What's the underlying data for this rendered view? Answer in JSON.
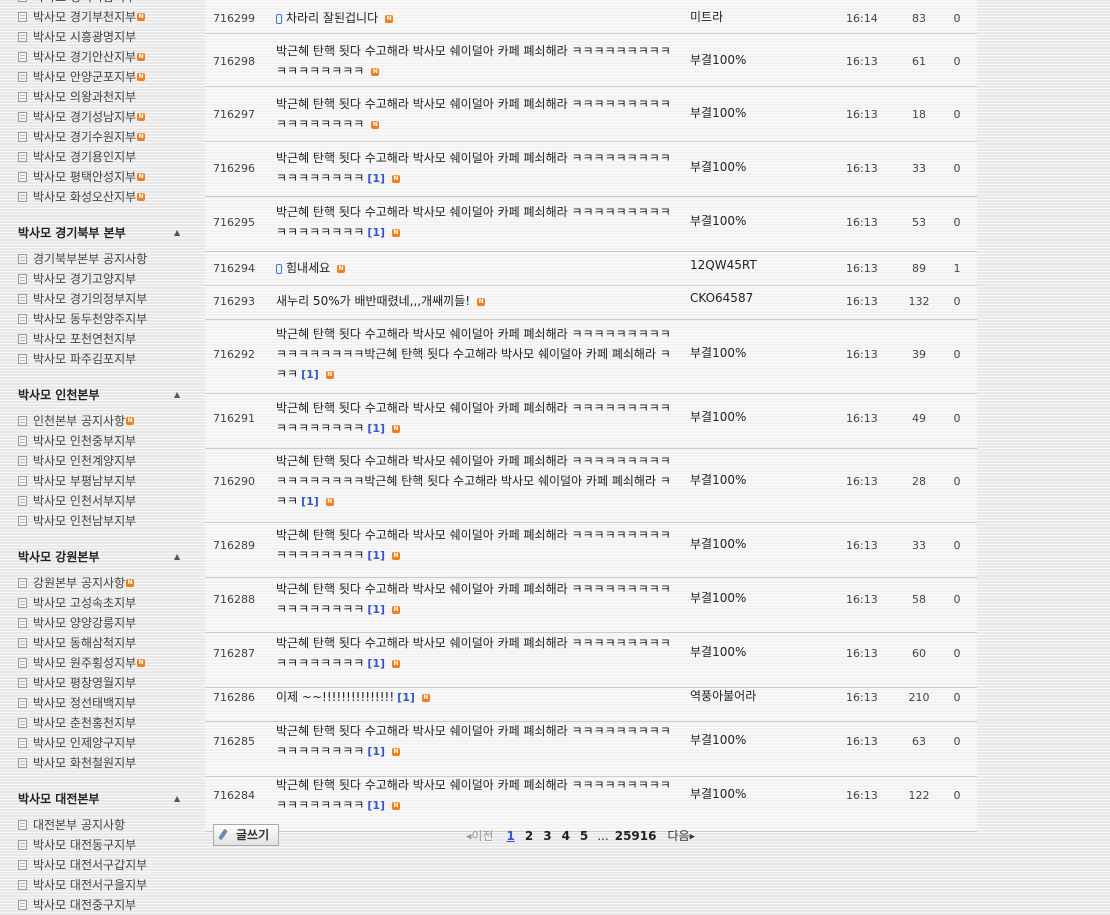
{
  "sidebar": {
    "groups": [
      {
        "header": "",
        "items": [
          {
            "label": "박사모 경기하남지부",
            "new": false
          },
          {
            "label": "박사모 경기부천지부",
            "new": true
          },
          {
            "label": "박사모 시흥광명지부",
            "new": false
          },
          {
            "label": "박사모 경기안산지부",
            "new": true
          },
          {
            "label": "박사모 안양군포지부",
            "new": true
          },
          {
            "label": "박사모 의왕과천지부",
            "new": false
          },
          {
            "label": "박사모 경기성남지부",
            "new": true
          },
          {
            "label": "박사모 경기수원지부",
            "new": true
          },
          {
            "label": "박사모 경기용인지부",
            "new": false
          },
          {
            "label": "박사모 평택안성지부",
            "new": true
          },
          {
            "label": "박사모 화성오산지부",
            "new": true
          }
        ]
      },
      {
        "header": "박사모 경기북부 본부",
        "items": [
          {
            "label": "경기북부본부 공지사항",
            "new": false
          },
          {
            "label": "박사모 경기고양지부",
            "new": false
          },
          {
            "label": "박사모 경기의정부지부",
            "new": false
          },
          {
            "label": "박사모 동두천양주지부",
            "new": false
          },
          {
            "label": "박사모 포천연천지부",
            "new": false
          },
          {
            "label": "박사모 파주김포지부",
            "new": false
          }
        ]
      },
      {
        "header": "박사모 인천본부",
        "items": [
          {
            "label": "인천본부 공지사항",
            "new": true
          },
          {
            "label": "박사모 인천중부지부",
            "new": false
          },
          {
            "label": "박사모 인천계양지부",
            "new": false
          },
          {
            "label": "박사모 부평남부지부",
            "new": false
          },
          {
            "label": "박사모 인천서부지부",
            "new": false
          },
          {
            "label": "박사모 인천남부지부",
            "new": false
          }
        ]
      },
      {
        "header": "박사모 강원본부",
        "items": [
          {
            "label": "강원본부 공지사항",
            "new": true
          },
          {
            "label": "박사모 고성속초지부",
            "new": false
          },
          {
            "label": "박사모 양양강릉지부",
            "new": false
          },
          {
            "label": "박사모 동해삼척지부",
            "new": false
          },
          {
            "label": "박사모 원주횡성지부",
            "new": true
          },
          {
            "label": "박사모 평창영월지부",
            "new": false
          },
          {
            "label": "박사모 정선태백지부",
            "new": false
          },
          {
            "label": "박사모 춘천홍천지부",
            "new": false
          },
          {
            "label": "박사모 인제양구지부",
            "new": false
          },
          {
            "label": "박사모 화천철원지부",
            "new": false
          }
        ]
      },
      {
        "header": "박사모 대전본부",
        "items": [
          {
            "label": "대전본부 공지사항",
            "new": false
          },
          {
            "label": "박사모 대전동구지부",
            "new": false
          },
          {
            "label": "박사모 대전서구갑지부",
            "new": false
          },
          {
            "label": "박사모 대전서구을지부",
            "new": false
          },
          {
            "label": "박사모 대전중구지부",
            "new": false
          }
        ]
      }
    ]
  },
  "icons": {
    "new_badge": "N",
    "new_badge_color": "#f07e1b",
    "comment_color": "#3b55c4",
    "mobile_icon": "mobile-phone-icon",
    "toggle_icon": "▲"
  },
  "posts": [
    {
      "no": "716299",
      "title": "차라리 잘된겁니다",
      "mobile": true,
      "comments": "",
      "author": "미트라",
      "time": "16:14",
      "hits": "83",
      "rec": "0"
    },
    {
      "no": "716298",
      "title": "박근혜 탄핵 됫다 수고해라 박사모 쉐이덜아 카페 폐쇠해라 ㅋㅋㅋㅋㅋㅋㅋㅋㅋㅋㅋㅋㅋㅋㅋㅋㅋ",
      "mobile": false,
      "comments": "",
      "author": "부결100%",
      "time": "16:13",
      "hits": "61",
      "rec": "0"
    },
    {
      "no": "716297",
      "title": "박근혜 탄핵 됫다 수고해라 박사모 쉐이덜아 카페 폐쇠해라 ㅋㅋㅋㅋㅋㅋㅋㅋㅋㅋㅋㅋㅋㅋㅋㅋㅋ",
      "mobile": false,
      "comments": "",
      "author": "부결100%",
      "time": "16:13",
      "hits": "18",
      "rec": "0"
    },
    {
      "no": "716296",
      "title": "박근혜 탄핵 됫다 수고해라 박사모 쉐이덜아 카페 폐쇠해라 ㅋㅋㅋㅋㅋㅋㅋㅋㅋㅋㅋㅋㅋㅋㅋㅋㅋ",
      "mobile": false,
      "comments": "[1]",
      "author": "부결100%",
      "time": "16:13",
      "hits": "33",
      "rec": "0"
    },
    {
      "no": "716295",
      "title": "박근혜 탄핵 됫다 수고해라 박사모 쉐이덜아 카페 폐쇠해라 ㅋㅋㅋㅋㅋㅋㅋㅋㅋㅋㅋㅋㅋㅋㅋㅋㅋ",
      "mobile": false,
      "comments": "[1]",
      "author": "부결100%",
      "time": "16:13",
      "hits": "53",
      "rec": "0"
    },
    {
      "no": "716294",
      "title": "힘내세요",
      "mobile": true,
      "comments": "",
      "author": "12QW45RT",
      "time": "16:13",
      "hits": "89",
      "rec": "1"
    },
    {
      "no": "716293",
      "title": "새누리 50%가 배반때렸네,,,개쌔끼들!",
      "mobile": false,
      "comments": "",
      "author": "CKO64587",
      "time": "16:13",
      "hits": "132",
      "rec": "0"
    },
    {
      "no": "716292",
      "title": "박근혜 탄핵 됫다 수고해라 박사모 쉐이덜아 카페 폐쇠해라 ㅋㅋㅋㅋㅋㅋㅋㅋㅋㅋㅋㅋㅋㅋㅋㅋㅋ박근혜 탄핵 됫다 수고해라 박사모 쉐이덜아 카페 폐쇠해라 ㅋㅋㅋ",
      "mobile": false,
      "comments": "[1]",
      "author": "부결100%",
      "time": "16:13",
      "hits": "39",
      "rec": "0"
    },
    {
      "no": "716291",
      "title": "박근혜 탄핵 됫다 수고해라 박사모 쉐이덜아 카페 폐쇠해라 ㅋㅋㅋㅋㅋㅋㅋㅋㅋㅋㅋㅋㅋㅋㅋㅋㅋ",
      "mobile": false,
      "comments": "[1]",
      "author": "부결100%",
      "time": "16:13",
      "hits": "49",
      "rec": "0"
    },
    {
      "no": "716290",
      "title": "박근혜 탄핵 됫다 수고해라 박사모 쉐이덜아 카페 폐쇠해라 ㅋㅋㅋㅋㅋㅋㅋㅋㅋㅋㅋㅋㅋㅋㅋㅋㅋ박근혜 탄핵 됫다 수고해라 박사모 쉐이덜아 카페 폐쇠해라 ㅋㅋㅋ",
      "mobile": false,
      "comments": "[1]",
      "author": "부결100%",
      "time": "16:13",
      "hits": "28",
      "rec": "0"
    },
    {
      "no": "716289",
      "title": "박근혜 탄핵 됫다 수고해라 박사모 쉐이덜아 카페 폐쇠해라 ㅋㅋㅋㅋㅋㅋㅋㅋㅋㅋㅋㅋㅋㅋㅋㅋㅋ",
      "mobile": false,
      "comments": "[1]",
      "author": "부결100%",
      "time": "16:13",
      "hits": "33",
      "rec": "0"
    },
    {
      "no": "716288",
      "title": "박근혜 탄핵 됫다 수고해라 박사모 쉐이덜아 카페 폐쇠해라 ㅋㅋㅋㅋㅋㅋㅋㅋㅋㅋㅋㅋㅋㅋㅋㅋㅋ",
      "mobile": false,
      "comments": "[1]",
      "author": "부결100%",
      "time": "16:13",
      "hits": "58",
      "rec": "0"
    },
    {
      "no": "716287",
      "title": "박근혜 탄핵 됫다 수고해라 박사모 쉐이덜아 카페 폐쇠해라 ㅋㅋㅋㅋㅋㅋㅋㅋㅋㅋㅋㅋㅋㅋㅋㅋㅋ",
      "mobile": false,
      "comments": "[1]",
      "author": "부결100%",
      "time": "16:13",
      "hits": "60",
      "rec": "0"
    },
    {
      "no": "716286",
      "title": "이제 ~~!!!!!!!!!!!!!!!",
      "mobile": false,
      "comments": "[1]",
      "author": "역풍아불어라",
      "time": "16:13",
      "hits": "210",
      "rec": "0"
    },
    {
      "no": "716285",
      "title": "박근혜 탄핵 됫다 수고해라 박사모 쉐이덜아 카페 폐쇠해라 ㅋㅋㅋㅋㅋㅋㅋㅋㅋㅋㅋㅋㅋㅋㅋㅋㅋ",
      "mobile": false,
      "comments": "[1]",
      "author": "부결100%",
      "time": "16:13",
      "hits": "63",
      "rec": "0"
    },
    {
      "no": "716284",
      "title": "박근혜 탄핵 됫다 수고해라 박사모 쉐이덜아 카페 폐쇠해라 ㅋㅋㅋㅋㅋㅋㅋㅋㅋㅋㅋㅋㅋㅋㅋㅋㅋ",
      "mobile": false,
      "comments": "[1]",
      "author": "부결100%",
      "time": "16:13",
      "hits": "122",
      "rec": "0"
    }
  ],
  "footer": {
    "write_label": "글쓰기",
    "prev_label": "이전",
    "next_label": "다음",
    "pages": [
      "1",
      "2",
      "3",
      "4",
      "5"
    ],
    "current_page": "1",
    "ellipsis": "...",
    "last_page": "25916"
  }
}
